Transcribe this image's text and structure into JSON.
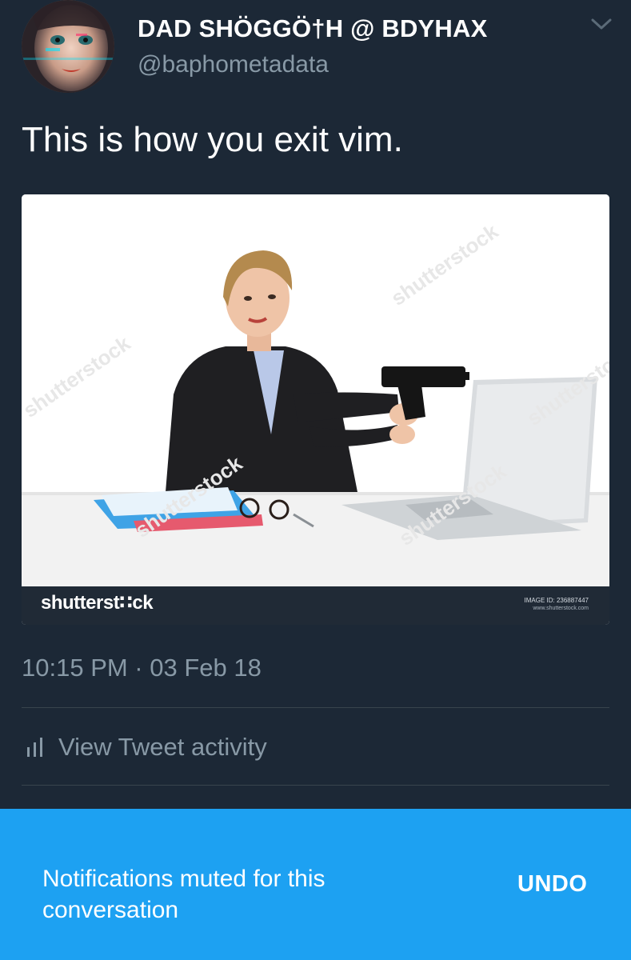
{
  "tweet": {
    "display_name": "DAD SHÖGGÖ†H @ BDYHAX",
    "handle": "@baphometadata",
    "text": "This is how you exit vim.",
    "timestamp": "10:15 PM · 03 Feb 18"
  },
  "media": {
    "logo": "shutterst∷ck",
    "image_id": "IMAGE ID: 236887447",
    "url": "www.shutterstock.com",
    "watermark_text": "shutterstock"
  },
  "actions": {
    "view_activity_label": "View Tweet activity"
  },
  "snackbar": {
    "message": "Notifications muted for this conversation",
    "undo_label": "UNDO"
  },
  "colors": {
    "background": "#1c2836",
    "secondary_text": "#8899a6",
    "accent": "#1da1f2",
    "divider": "#38444d"
  },
  "icons": {
    "menu": "chevron-down-icon",
    "activity": "bar-chart-icon"
  }
}
